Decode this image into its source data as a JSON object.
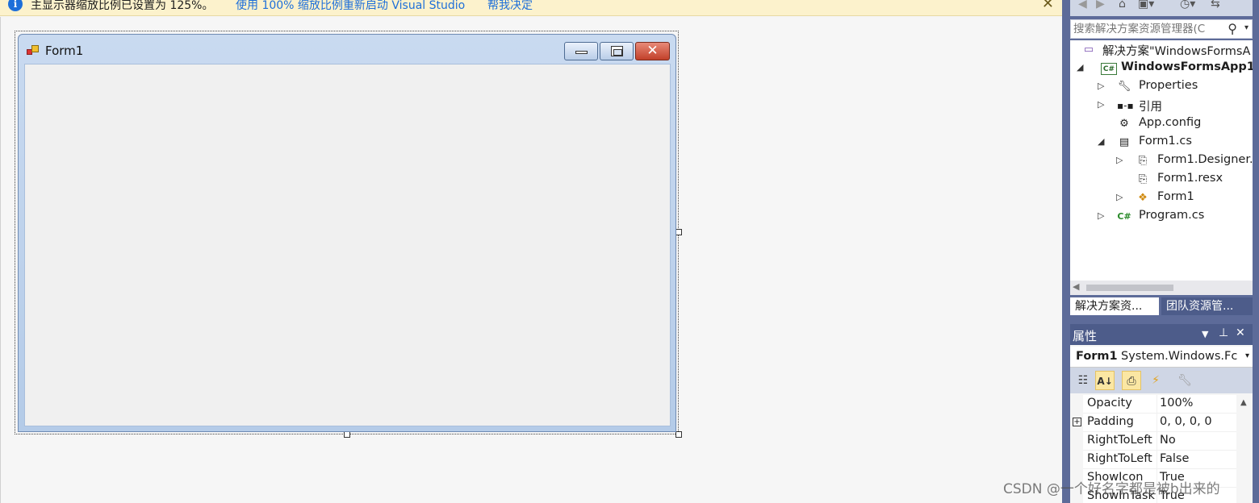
{
  "infobar": {
    "message": "主显示器缩放比例已设置为 125%。",
    "link_restart": "使用 100% 缩放比例重新启动 Visual Studio",
    "link_help": "帮我决定"
  },
  "designer": {
    "form_title": "Form1"
  },
  "solution_explorer": {
    "search_placeholder": "搜索解决方案资源管理器(C",
    "solution_label": "解决方案\"WindowsFormsA",
    "project": "WindowsFormsApp1",
    "items": {
      "properties": "Properties",
      "references": "引用",
      "app_config": "App.config",
      "form1_cs": "Form1.cs",
      "form1_designer": "Form1.Designer.",
      "form1_resx": "Form1.resx",
      "form1_class": "Form1",
      "program_cs": "Program.cs"
    },
    "tabs": {
      "solution": "解决方案资...",
      "team": "团队资源管..."
    }
  },
  "properties_panel": {
    "title": "属性",
    "object_name": "Form1",
    "object_type": "System.Windows.Fc",
    "rows": [
      {
        "name": "Opacity",
        "value": "100%"
      },
      {
        "name": "Padding",
        "value": "0, 0, 0, 0"
      },
      {
        "name": "RightToLeft",
        "value": "No"
      },
      {
        "name": "RightToLeft",
        "value": "False"
      },
      {
        "name": "ShowIcon",
        "value": "True"
      },
      {
        "name": "ShowInTask",
        "value": "True"
      }
    ]
  },
  "watermark": "CSDN @一个好名字都是被b出来的",
  "colors": {
    "infobar_bg": "#fcf2cc",
    "link": "#1e6fd9",
    "panel_frame": "#5d6b99",
    "tab_active_bg": "#ffffff",
    "tab_inactive_bg": "#4d5c8a"
  }
}
